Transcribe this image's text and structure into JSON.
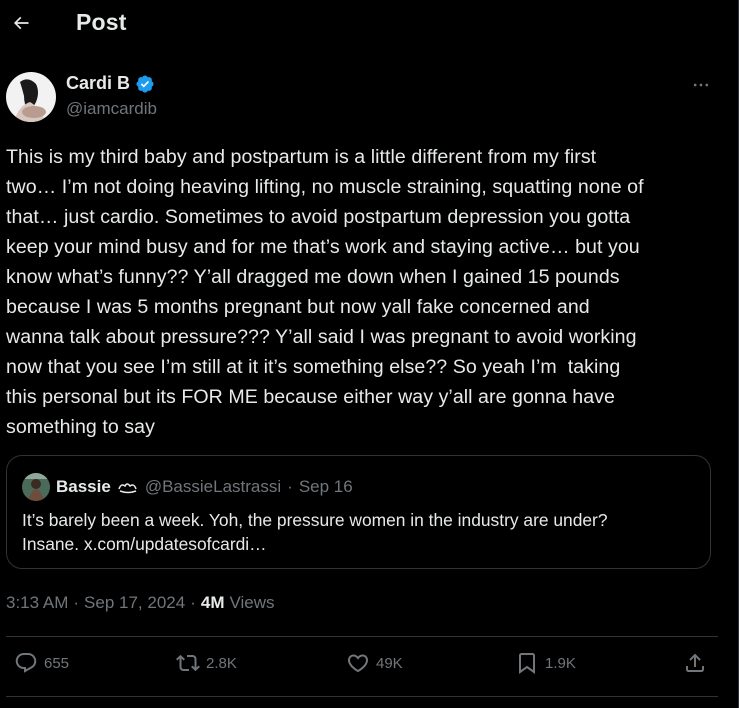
{
  "header": {
    "back_icon": "arrow-left-icon",
    "title": "Post"
  },
  "author": {
    "name": "Cardi B",
    "handle": "@iamcardib",
    "verified_color": "#1d9bf0"
  },
  "tweet": {
    "text": "This is my third baby and postpartum is a little different from my first\ntwo… I’m not doing heaving lifting, no muscle straining, squatting none of\nthat… just cardio. Sometimes to avoid postpartum depression you gotta\nkeep your mind busy and for me that’s work and staying active… but you\nknow what’s funny?? Y’all dragged me down when I gained 15 pounds\nbecause I was 5 months pregnant but now yall fake concerned and\nwanna talk about pressure??? Y’all said I was pregnant to avoid working\nnow that you see I’m still at it it’s something else?? So yeah I’m  taking\nthis personal but its FOR ME because either way y’all are gonna have\nsomething to say"
  },
  "quote": {
    "name": "Bassie",
    "badge_icon": "affiliate-badge-icon",
    "handle": "@BassieLastrassi",
    "separator": "·",
    "date": "Sep 16",
    "text": "It’s barely been a week. Yoh, the pressure women in the industry are under?\nInsane. x.com/updatesofcardi…"
  },
  "meta": {
    "time": "3:13 AM",
    "sep1": "·",
    "date": "Sep 17, 2024",
    "sep2": "·",
    "views_count": "4M",
    "views_label": "Views"
  },
  "actions": {
    "replies": "655",
    "reposts": "2.8K",
    "likes": "49K",
    "bookmarks": "1.9K"
  },
  "colors": {
    "background": "#000000",
    "text": "#e7e9ea",
    "secondary": "#71767b",
    "border": "#2f3336",
    "accent": "#1d9bf0"
  }
}
